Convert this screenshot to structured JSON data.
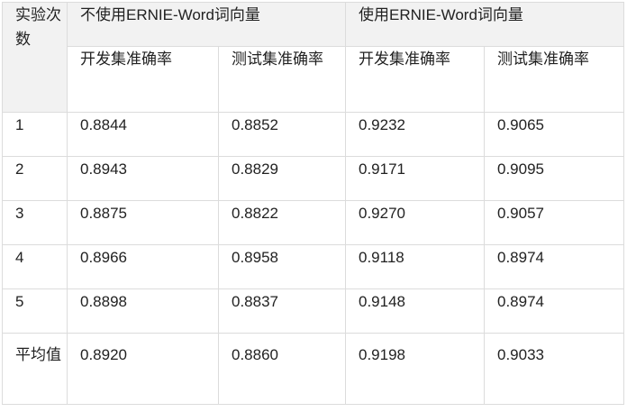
{
  "table": {
    "corner": "实验次数",
    "groups": [
      {
        "label": "不使用ERNIE-Word词向量",
        "columns": [
          "开发集准确率",
          "测试集准确率"
        ]
      },
      {
        "label": "使用ERNIE-Word词向量",
        "columns": [
          "开发集准确率",
          "测试集准确率"
        ]
      }
    ],
    "rows": [
      {
        "label": "1",
        "values": [
          "0.8844",
          "0.8852",
          "0.9232",
          "0.9065"
        ]
      },
      {
        "label": "2",
        "values": [
          "0.8943",
          "0.8829",
          "0.9171",
          "0.9095"
        ]
      },
      {
        "label": "3",
        "values": [
          "0.8875",
          "0.8822",
          "0.9270",
          "0.9057"
        ]
      },
      {
        "label": "4",
        "values": [
          "0.8966",
          "0.8958",
          "0.9118",
          "0.8974"
        ]
      },
      {
        "label": "5",
        "values": [
          "0.8898",
          "0.8837",
          "0.9148",
          "0.8974"
        ]
      },
      {
        "label": "平均值",
        "values": [
          "0.8920",
          "0.8860",
          "0.9198",
          "0.9033"
        ]
      }
    ]
  }
}
